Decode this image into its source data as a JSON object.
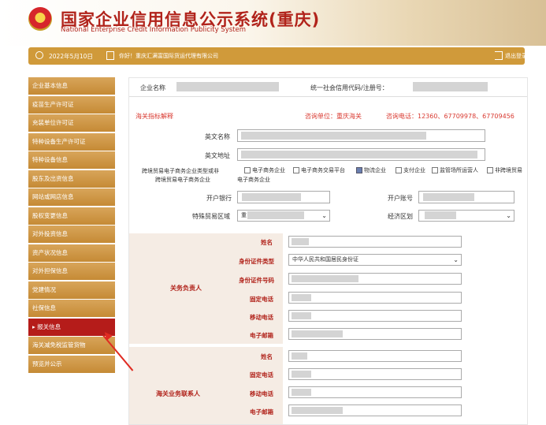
{
  "header": {
    "title_cn": "国家企业信用信息公示系统(重庆)",
    "title_en": "National Enterprise Credit Information Publicity System"
  },
  "topbar": {
    "date": "2022年5月10日",
    "greeting": "你好！重庆汇满富国际货运代理有限公司",
    "logout": "退出登录"
  },
  "sidebar": {
    "items": [
      {
        "label": "企业基本信息"
      },
      {
        "label": "疫苗生产许可证"
      },
      {
        "label": "充装单位许可证"
      },
      {
        "label": "特种设备生产许可证"
      },
      {
        "label": "特种设备信息"
      },
      {
        "label": "股东及出资信息"
      },
      {
        "label": "网站或网店信息"
      },
      {
        "label": "股权变更信息"
      },
      {
        "label": "对外投资信息"
      },
      {
        "label": "资产状况信息"
      },
      {
        "label": "对外担保信息"
      },
      {
        "label": "党建情况"
      },
      {
        "label": "社保信息"
      },
      {
        "label": "▸ 报关信息"
      },
      {
        "label": "海关减免税监管货物"
      },
      {
        "label": "预览并公示"
      }
    ]
  },
  "main": {
    "company_label": "企业名称",
    "credit_code_label": "统一社会信用代码/注册号：",
    "customs_explain": "海关指标解释",
    "consult_unit": "咨询单位：重庆海关",
    "consult_phone": "咨询电话：12360、67709978、67709456",
    "en_name_label": "英文名称",
    "en_addr_label": "英文地址",
    "ecommerce_label_1": "跨境贸易电子商务企业类型或非",
    "ecommerce_label_2": "跨境贸易电子商务企业",
    "ecommerce_suffix": "电子商务企业",
    "checkboxes": [
      {
        "label": "电子商务企业",
        "checked": false
      },
      {
        "label": "电子商务交易平台",
        "checked": false
      },
      {
        "label": "物流企业",
        "checked": true
      },
      {
        "label": "支付企业",
        "checked": false
      },
      {
        "label": "监管场所运营人",
        "checked": false
      },
      {
        "label": "非跨境贸易",
        "checked": false
      }
    ],
    "bank_label": "开户银行",
    "account_label": "开户账号",
    "zone_label": "特殊贸易区域",
    "zone_value": "重",
    "econ_label": "经济区划"
  },
  "customs_leader": {
    "section_label": "关务负责人",
    "name_label": "姓名",
    "id_type_label": "身份证件类型",
    "id_type_value": "中华人民共和国居民身份证",
    "id_no_label": "身份证件号码",
    "phone_label": "固定电话",
    "mobile_label": "移动电话",
    "email_label": "电子邮箱"
  },
  "customs_contact": {
    "section_label": "海关业务联系人",
    "name_label": "姓名",
    "phone_label": "固定电话",
    "mobile_label": "移动电话",
    "email_label": "电子邮箱"
  }
}
